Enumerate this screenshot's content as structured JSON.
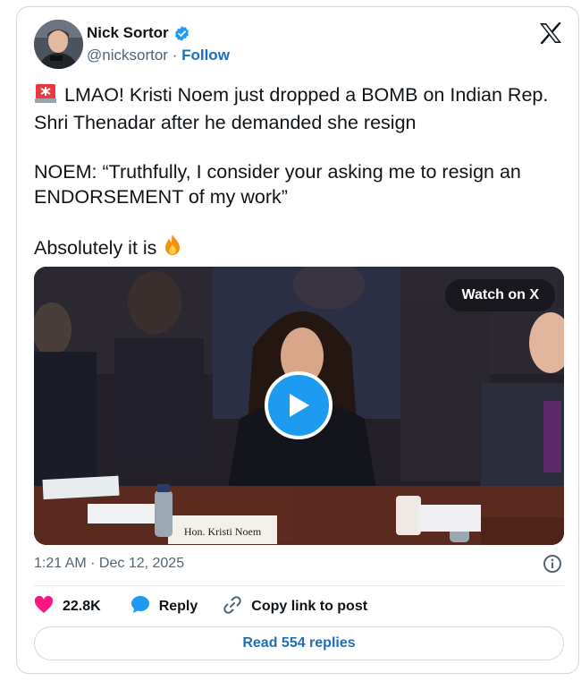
{
  "colors": {
    "accent": "#1d9bf0",
    "link": "#1d6fb8",
    "like": "#f91880",
    "muted": "#536471"
  },
  "author": {
    "name": "Nick Sortor",
    "handle": "@nicksortor",
    "separator": "·",
    "follow_label": "Follow",
    "verified": true
  },
  "tweet": {
    "lines": [
      "LMAO! Kristi Noem just dropped a BOMB on Indian Rep. Shri Thenadar after he demanded she resign",
      "NOEM: “Truthfully, I consider your asking me to resign an ENDORSEMENT of my work”",
      "Absolutely it is"
    ],
    "leading_emoji": "siren-icon",
    "trailing_emoji": "fire-icon"
  },
  "media": {
    "watch_label": "Watch on X",
    "nameplate": "Hon. Kristi Noem",
    "play_icon": "play-icon"
  },
  "meta": {
    "timestamp": "1:21 AM · Dec 12, 2025"
  },
  "actions": {
    "like_count": "22.8K",
    "reply_label": "Reply",
    "copy_label": "Copy link to post"
  },
  "footer": {
    "read_replies_label": "Read 554 replies"
  }
}
